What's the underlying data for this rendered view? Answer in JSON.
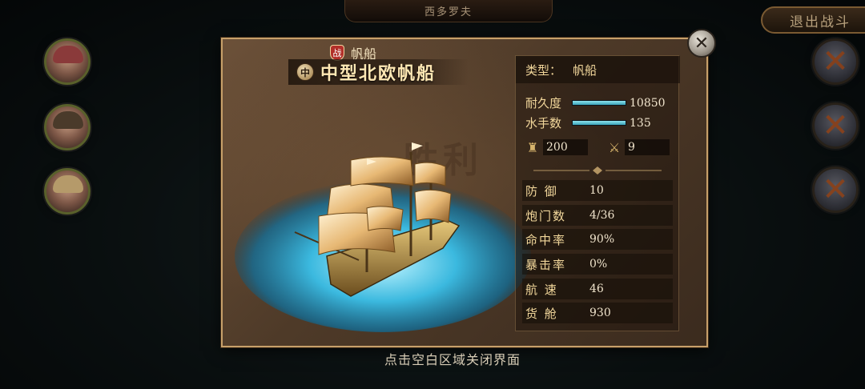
{
  "top_banner": "西多罗夫",
  "exit_button": "退出战斗",
  "close_icon": "x-icon",
  "ship": {
    "category_label": "帆船",
    "battle_badge": "战",
    "size_badge": "中",
    "name": "中型北欧帆船",
    "watermark": "胜利"
  },
  "stats": {
    "type_label": "类型：",
    "type_value": "帆船",
    "durability": {
      "label": "耐久度",
      "value": "10850",
      "fill": 1.0
    },
    "sailors": {
      "label": "水手数",
      "value": "135",
      "fill": 1.0
    },
    "supplies": {
      "icon": "supply-sack-icon",
      "value": "200"
    },
    "combat": {
      "icon": "crossed-swords-icon",
      "value": "9"
    },
    "attributes": [
      {
        "label": "防 御",
        "value": "10"
      },
      {
        "label": "炮门数",
        "value": "4/36"
      },
      {
        "label": "命中率",
        "value": "90%"
      },
      {
        "label": "暴击率",
        "value": "0%"
      },
      {
        "label": "航 速",
        "value": "46"
      },
      {
        "label": "货 舱",
        "value": "930"
      }
    ]
  },
  "hint": "点击空白区域关闭界面",
  "colors": {
    "panel_border": "#c7a06a",
    "bar_fill": "#5cc6d6",
    "label_gold": "#f2d79b",
    "battle_badge_red": "#b2302a"
  }
}
